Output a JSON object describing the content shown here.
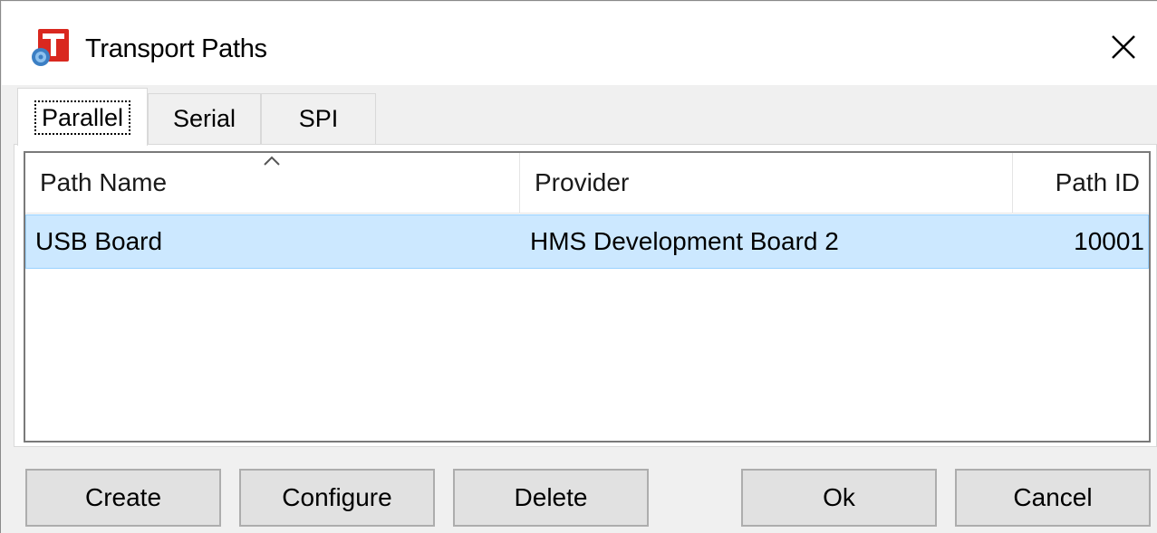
{
  "window": {
    "title": "Transport Paths",
    "icon": "app-t-icon",
    "close_icon": "close-icon"
  },
  "tabs": [
    {
      "label": "Parallel",
      "active": true
    },
    {
      "label": "Serial",
      "active": false
    },
    {
      "label": "SPI",
      "active": false
    }
  ],
  "table": {
    "columns": [
      "Path Name",
      "Provider",
      "Path ID"
    ],
    "sort_column": "Path Name",
    "sort_direction": "ascending",
    "rows": [
      {
        "path_name": "USB Board",
        "provider": "HMS Development Board 2",
        "path_id": "10001",
        "selected": true
      }
    ]
  },
  "buttons": {
    "create": "Create",
    "configure": "Configure",
    "delete": "Delete",
    "ok": "Ok",
    "cancel": "Cancel"
  },
  "colors": {
    "selection_bg": "#cce8ff",
    "selection_border": "#99d1ff",
    "icon_red": "#d9281f",
    "button_bg": "#e1e1e1"
  }
}
